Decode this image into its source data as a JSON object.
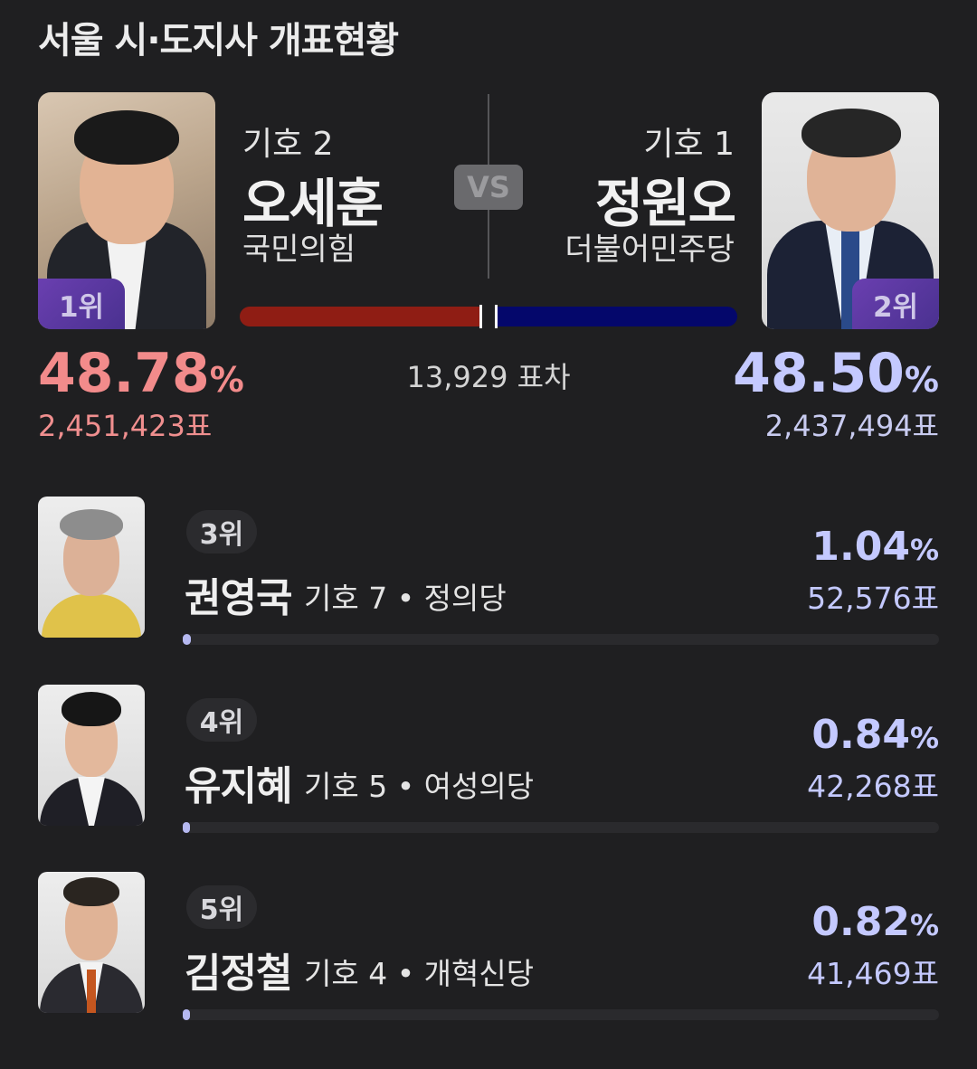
{
  "page_title": "서울 시·도지사 개표현황",
  "vs_label": "VS",
  "leader": {
    "rank": "1위",
    "number": "기호 2",
    "name": "오세훈",
    "party": "국민의힘",
    "percent": "48.78",
    "unit": "%",
    "votes": "2,451,423표",
    "bar_color": "#8f1d14"
  },
  "runner_up": {
    "rank": "2위",
    "number": "기호 1",
    "name": "정원오",
    "party": "더불어민주당",
    "percent": "48.50",
    "unit": "%",
    "votes": "2,437,494표",
    "bar_color": "#04076b"
  },
  "margin_text": "13,929 표차",
  "others": [
    {
      "rank": "3위",
      "name": "권영국",
      "detail": "기호 7 • 정의당",
      "percent": "1.04",
      "unit": "%",
      "votes": "52,576표",
      "share": 1.04
    },
    {
      "rank": "4위",
      "name": "유지혜",
      "detail": "기호 5 • 여성의당",
      "percent": "0.84",
      "unit": "%",
      "votes": "42,268표",
      "share": 0.84
    },
    {
      "rank": "5위",
      "name": "김정철",
      "detail": "기호 4 • 개혁신당",
      "percent": "0.82",
      "unit": "%",
      "votes": "41,469표",
      "share": 0.82
    }
  ]
}
